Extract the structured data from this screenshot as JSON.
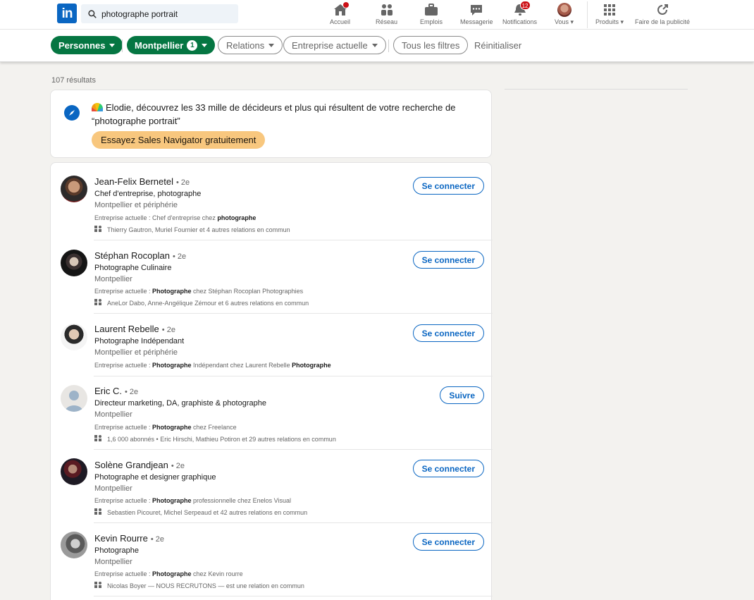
{
  "search": {
    "value": "photographe portrait"
  },
  "nav": [
    {
      "id": "home",
      "label": "Accueil",
      "icon": "home-icon",
      "badge": "dot"
    },
    {
      "id": "network",
      "label": "Réseau",
      "icon": "network-icon"
    },
    {
      "id": "jobs",
      "label": "Emplois",
      "icon": "briefcase-icon"
    },
    {
      "id": "messaging",
      "label": "Messagerie",
      "icon": "message-icon"
    },
    {
      "id": "notifications",
      "label": "Notifications",
      "icon": "bell-icon",
      "badge": "12"
    },
    {
      "id": "me",
      "label": "Vous",
      "icon": "avatar"
    },
    {
      "id": "products",
      "label": "Produits",
      "icon": "grid-icon"
    },
    {
      "id": "advertise",
      "label": "Faire de la publicité",
      "icon": "advertise-icon"
    }
  ],
  "filters": {
    "personnes": "Personnes",
    "montpellier": "Montpellier",
    "montpellier_count": "1",
    "relations": "Relations",
    "entreprise": "Entreprise actuelle",
    "tous": "Tous les filtres",
    "reset": "Réinitialiser"
  },
  "results_count": "107 résultats",
  "promo": {
    "line": "Elodie, découvrez les 33 mille de décideurs et plus qui résultent de votre recherche de “photographe portrait”",
    "button": "Essayez Sales Navigator gratuitement"
  },
  "accent": "#0a66c2",
  "green": "#057642",
  "people": [
    {
      "name": "Jean-Felix Bernetel",
      "degree": "• 2e",
      "title": "Chef d'entreprise, photographe",
      "location": "Montpellier et périphérie",
      "current_prefix": "Entreprise actuelle : ",
      "current_rich": "Chef d'entreprise chez <b>photographe</b>",
      "mutual": "Thierry Gautron, Muriel Fournier et 4 autres relations en commun",
      "action": "Se connecter"
    },
    {
      "name": "Stéphan Rocoplan",
      "degree": "• 2e",
      "title": "Photographe Culinaire",
      "location": "Montpellier",
      "current_prefix": "Entreprise actuelle : ",
      "current_rich": "<b>Photographe</b> chez Stéphan Rocoplan Photographies",
      "mutual": "AneLor Dabo, Anne-Angélique Zémour et 6 autres relations en commun",
      "action": "Se connecter"
    },
    {
      "name": "Laurent Rebelle",
      "degree": "• 2e",
      "title": "Photographe Indépendant",
      "location": "Montpellier et périphérie",
      "current_prefix": "Entreprise actuelle : ",
      "current_rich": "<b>Photographe</b> Indépendant chez Laurent Rebelle <b>Photographe</b>",
      "mutual": "",
      "action": "Se connecter"
    },
    {
      "name": "Eric C.",
      "degree": "• 2e",
      "title": "Directeur marketing, DA, graphiste & photographe",
      "location": "Montpellier",
      "current_prefix": "Entreprise actuelle : ",
      "current_rich": "<b>Photographe</b> chez Freelance",
      "mutual": "1,6 000 abonnés • Eric Hirschi, Mathieu Potiron et 29 autres relations en commun",
      "action": "Suivre"
    },
    {
      "name": "Solène Grandjean",
      "degree": "• 2e",
      "title": "Photographe et designer graphique",
      "location": "Montpellier",
      "current_prefix": "Entreprise actuelle : ",
      "current_rich": "<b>Photographe</b> professionnelle chez Enelos Visual",
      "mutual": "Sebastien Picouret, Michel Serpeaud et 42 autres relations en commun",
      "action": "Se connecter"
    },
    {
      "name": "Kevin Rourre",
      "degree": "• 2e",
      "title": "Photographe",
      "location": "Montpellier",
      "current_prefix": "Entreprise actuelle : ",
      "current_rich": "<b>Photographe</b> chez Kevin rourre",
      "mutual": "Nicolas Boyer — NOUS RECRUTONS — est une relation en commun",
      "action": "Se connecter"
    }
  ]
}
